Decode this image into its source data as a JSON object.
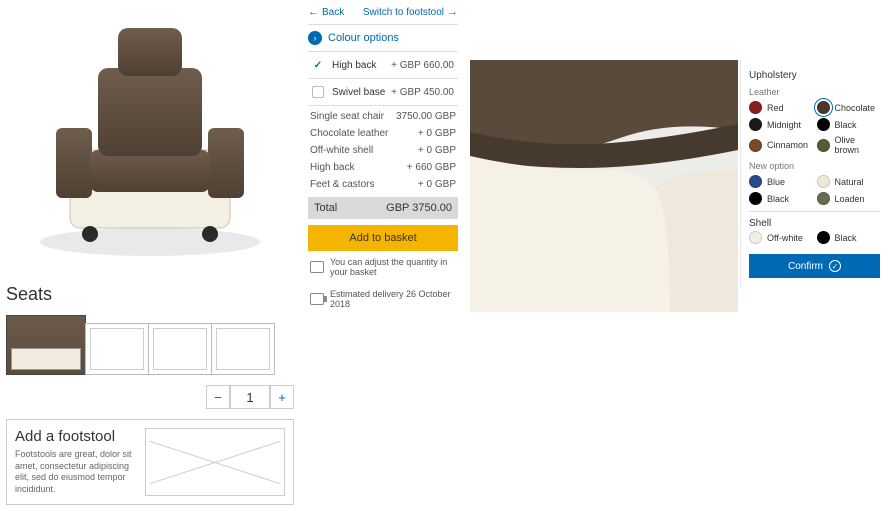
{
  "nav": {
    "back": "Back",
    "switch": "Switch to footstool"
  },
  "colour_section": "Colour options",
  "options": [
    {
      "name": "High back",
      "price": "+ GBP 660.00",
      "checked": true
    },
    {
      "name": "Swivel base",
      "price": "+ GBP 450.00",
      "checked": false
    }
  ],
  "lines": [
    {
      "name": "Single seat chair",
      "price": "3750.00 GBP"
    },
    {
      "name": "Chocolate leather",
      "price": "+ 0 GBP"
    },
    {
      "name": "Off-white shell",
      "price": "+ 0 GBP"
    },
    {
      "name": "High back",
      "price": "+ 660 GBP"
    },
    {
      "name": "Feet & castors",
      "price": "+ 0 GBP"
    }
  ],
  "total": {
    "label": "Total",
    "value": "GBP 3750.00"
  },
  "add_btn": "Add to basket",
  "info1": "You can adjust the quantity in your basket",
  "info2": "Estimated delivery 26 October 2018",
  "seats_hdr": "Seats",
  "qty": "1",
  "footstool": {
    "title": "Add a footstool",
    "desc": "Footstools are great, dolor sit amet, consectetur adipiscing elit, sed do eiusmod tempor incididunt."
  },
  "sidebar": {
    "upholstery": "Upholstery",
    "leather": "Leather",
    "leather_items": [
      {
        "name": "Red",
        "color": "#8a1f1f"
      },
      {
        "name": "Chocolate",
        "color": "#4a382b",
        "selected": true
      },
      {
        "name": "Midnight",
        "color": "#1a1a1a"
      },
      {
        "name": "Black",
        "color": "#000000"
      },
      {
        "name": "Cinnamon",
        "color": "#7a4a28"
      },
      {
        "name": "Olive brown",
        "color": "#5a5a36"
      }
    ],
    "new_option": "New option",
    "new_items": [
      {
        "name": "Blue",
        "color": "#2a4a8a"
      },
      {
        "name": "Natural",
        "color": "#efe8d8"
      },
      {
        "name": "Black",
        "color": "#000000"
      },
      {
        "name": "Loaden",
        "color": "#6a6a52"
      }
    ],
    "shell": "Shell",
    "shell_items": [
      {
        "name": "Off-white",
        "color": "#f3efe5"
      },
      {
        "name": "Black",
        "color": "#000000"
      }
    ],
    "confirm": "Confirm"
  }
}
